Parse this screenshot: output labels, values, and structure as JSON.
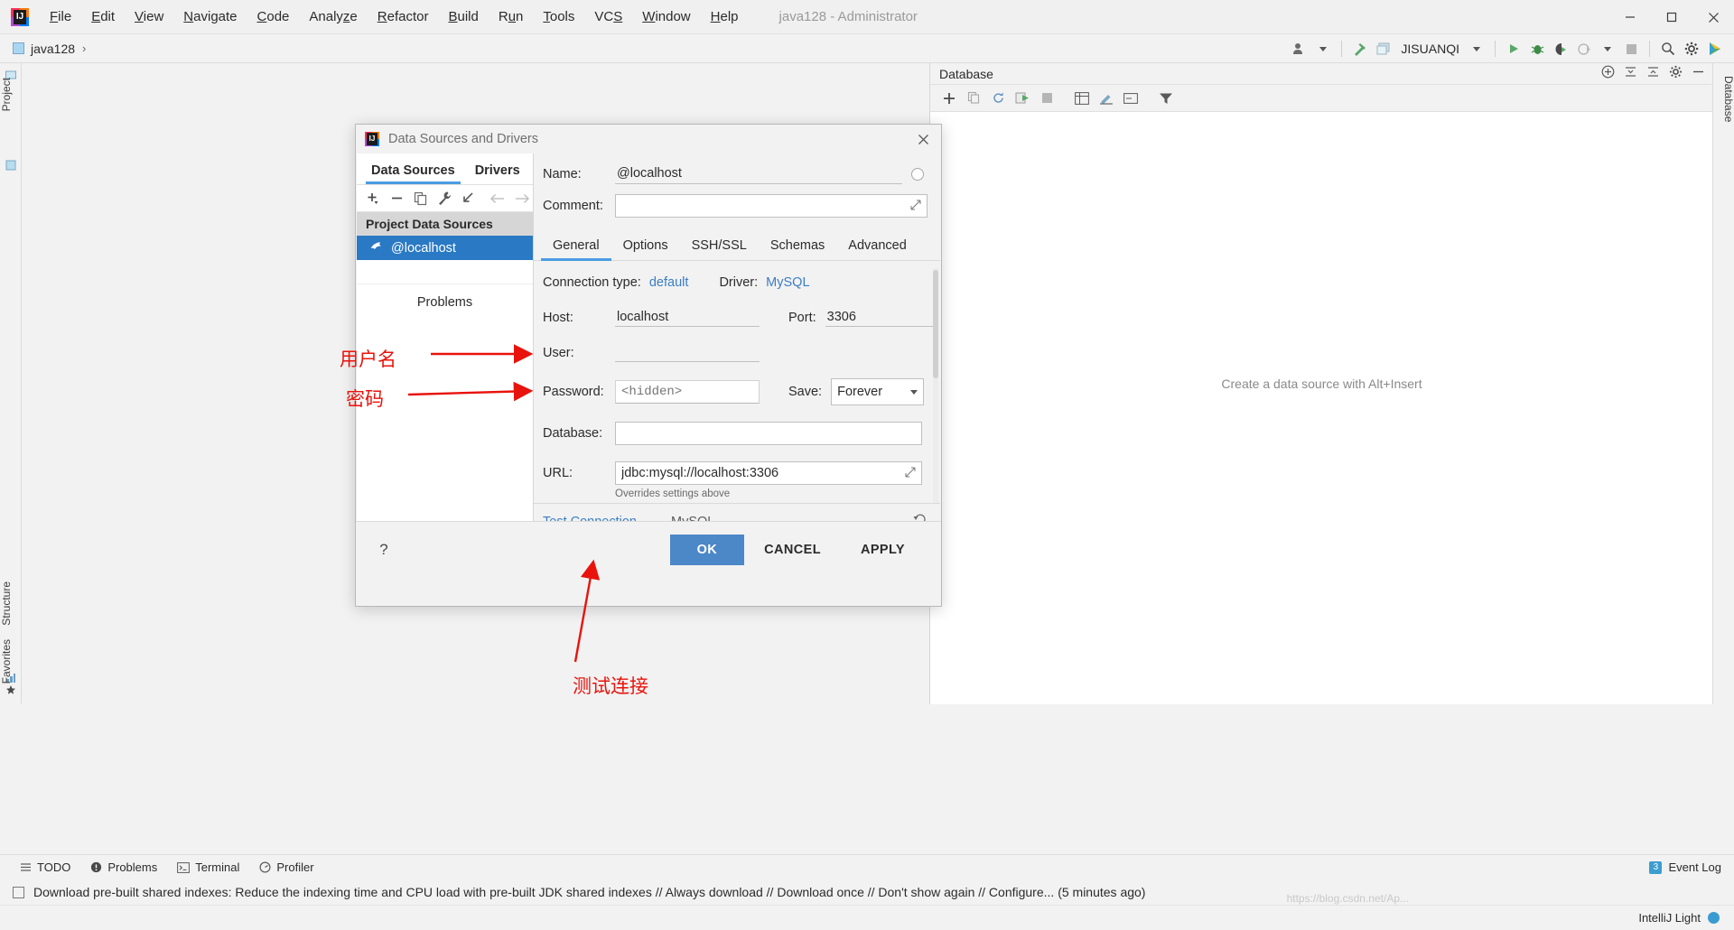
{
  "window": {
    "title": "java128 - Administrator",
    "minimize": "—",
    "maximize": "❐",
    "close": "✕"
  },
  "menubar": {
    "items": [
      {
        "label": "File",
        "mnemonic": "F"
      },
      {
        "label": "Edit",
        "mnemonic": "E"
      },
      {
        "label": "View",
        "mnemonic": "V"
      },
      {
        "label": "Navigate",
        "mnemonic": "N"
      },
      {
        "label": "Code",
        "mnemonic": "C"
      },
      {
        "label": "Analyze",
        "mnemonic": "z"
      },
      {
        "label": "Refactor",
        "mnemonic": "R"
      },
      {
        "label": "Build",
        "mnemonic": "B"
      },
      {
        "label": "Run",
        "mnemonic": "u"
      },
      {
        "label": "Tools",
        "mnemonic": "T"
      },
      {
        "label": "VCS",
        "mnemonic": "S"
      },
      {
        "label": "Window",
        "mnemonic": "W"
      },
      {
        "label": "Help",
        "mnemonic": "H"
      }
    ]
  },
  "navbar": {
    "breadcrumb": "java128",
    "separator": "›",
    "run_config": "JISUANQI"
  },
  "left_strip": {
    "project_tab": "Project",
    "structure_tab": "Structure",
    "favorites_tab": "Favorites"
  },
  "right_strip": {
    "database_tab": "Database"
  },
  "database_panel": {
    "title": "Database",
    "empty_hint": "Create a data source with Alt+Insert"
  },
  "status_tabs": {
    "todo": "TODO",
    "problems": "Problems",
    "terminal": "Terminal",
    "profiler": "Profiler",
    "event_log": "Event Log",
    "event_log_count": "3"
  },
  "notification": {
    "text": "Download pre-built shared indexes: Reduce the indexing time and CPU load with pre-built JDK shared indexes // Always download // Download once // Don't show again // Configure... (5 minutes ago)"
  },
  "bottom": {
    "theme_label": "IntelliJ Light",
    "watermark": "https://blog.csdn.net/Ap..."
  },
  "dialog": {
    "title": "Data Sources and Drivers",
    "close": "✕",
    "left": {
      "tabs": [
        {
          "label": "Data Sources",
          "active": true
        },
        {
          "label": "Drivers",
          "active": false
        }
      ],
      "group_header": "Project Data Sources",
      "selected_source": "@localhost",
      "problems_label": "Problems"
    },
    "form": {
      "name_label": "Name:",
      "name_value": "@localhost",
      "comment_label": "Comment:",
      "comment_value": "",
      "tabs": [
        {
          "label": "General",
          "active": true
        },
        {
          "label": "Options",
          "active": false
        },
        {
          "label": "SSH/SSL",
          "active": false
        },
        {
          "label": "Schemas",
          "active": false
        },
        {
          "label": "Advanced",
          "active": false
        }
      ],
      "connection_type_label": "Connection type:",
      "connection_type_value": "default",
      "driver_label": "Driver:",
      "driver_value": "MySQL",
      "host_label": "Host:",
      "host_value": "localhost",
      "port_label": "Port:",
      "port_value": "3306",
      "user_label": "User:",
      "user_value": "",
      "password_label": "Password:",
      "password_placeholder": "<hidden>",
      "save_label": "Save:",
      "save_value": "Forever",
      "database_label": "Database:",
      "database_value": "",
      "url_label": "URL:",
      "url_value": "jdbc:mysql://localhost:3306",
      "overrides_note": "Overrides settings above"
    },
    "test": {
      "link": "Test Connection",
      "driver": "MySQL"
    },
    "footer": {
      "help": "?",
      "ok": "OK",
      "cancel": "CANCEL",
      "apply": "APPLY"
    }
  },
  "annotations": {
    "username": "用户名",
    "password": "密码",
    "test_connection": "测试连接",
    "color": "#e8130c"
  },
  "colors": {
    "accent_blue": "#4b9ce3",
    "selection_blue": "#2a79c4",
    "link_blue": "#3b7dc4",
    "ok_button": "#4c87c8"
  }
}
